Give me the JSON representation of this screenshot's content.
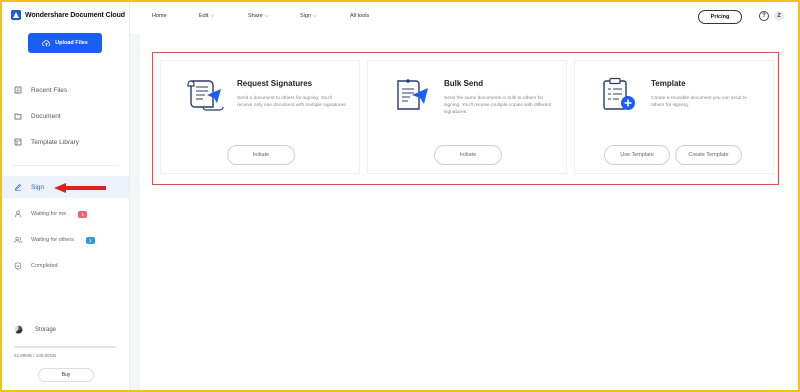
{
  "app": {
    "name": "Wondershare Document Cloud"
  },
  "sidebar": {
    "upload_label": "Upload Files",
    "items": [
      {
        "label": "Recent Files",
        "icon": "recent-files-icon"
      },
      {
        "label": "Document",
        "icon": "document-icon"
      },
      {
        "label": "Template Library",
        "icon": "template-library-icon"
      },
      {
        "label": "Sign",
        "icon": "pen-icon"
      }
    ],
    "sign_sub": [
      {
        "label": "Waiting for me",
        "badge": "1",
        "badge_color": "#e9696a"
      },
      {
        "label": "Waiting for others",
        "badge": "1",
        "badge_color": "#2f9bd9"
      },
      {
        "label": "Completed"
      }
    ],
    "storage_label": "Storage",
    "storage_text": "52.89MB / 100.00GB",
    "storage_fraction": 0.0005,
    "buy_label": "Buy"
  },
  "topbar": {
    "nav": [
      "Home",
      "Edit",
      "Share",
      "Sign",
      "All tools"
    ],
    "pricing_label": "Pricing",
    "help_label": "?",
    "avatar_letter": "Z"
  },
  "cards": [
    {
      "title": "Request Signatures",
      "desc": "Send a document to others for signing. You'll receive only one document with multiple signatures.",
      "buttons": [
        "Initiate"
      ],
      "icon": "request-signatures-icon"
    },
    {
      "title": "Bulk Send",
      "desc": "Send the same documents in bulk to others for signing. You'll receive multiple copies with different signatures.",
      "buttons": [
        "Initiate"
      ],
      "icon": "bulk-send-icon"
    },
    {
      "title": "Template",
      "desc": "Create a reusable document you can send to others for signing.",
      "buttons": [
        "Use Template",
        "Create Template"
      ],
      "icon": "template-icon"
    }
  ],
  "colors": {
    "accent": "#1a5ef5",
    "highlight_border": "#d9534f",
    "arrow": "#e02020",
    "active_bg": "#eef2fb"
  }
}
